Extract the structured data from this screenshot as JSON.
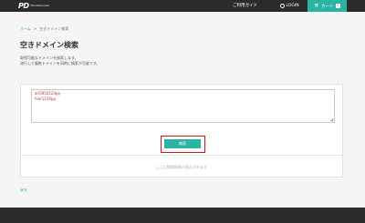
{
  "header": {
    "logo_mark": "PD",
    "logo_text": "PandaDomain",
    "guide_label": "ご利用ガイド",
    "login_label": "LOGIN",
    "cart_label": "カート",
    "cart_count": "0"
  },
  "breadcrumb": {
    "home": "ホーム",
    "separator": ">",
    "current": "空きドメイン検索"
  },
  "main": {
    "title": "空きドメイン検索",
    "desc_line1": "取得可能なドメインを検索します。",
    "desc_line2": "改行して複数ドメインを同時に検索が可能です。",
    "domains": [
      "ari5050124pp",
      "hiar1234pp"
    ],
    "search_label": "検索",
    "result_placeholder": "ここに検索結果が表示されます",
    "back_label": "戻る"
  },
  "colors": {
    "accent": "#2bb3a3",
    "highlight": "#d01818",
    "header_bg": "#2b2b2b"
  }
}
